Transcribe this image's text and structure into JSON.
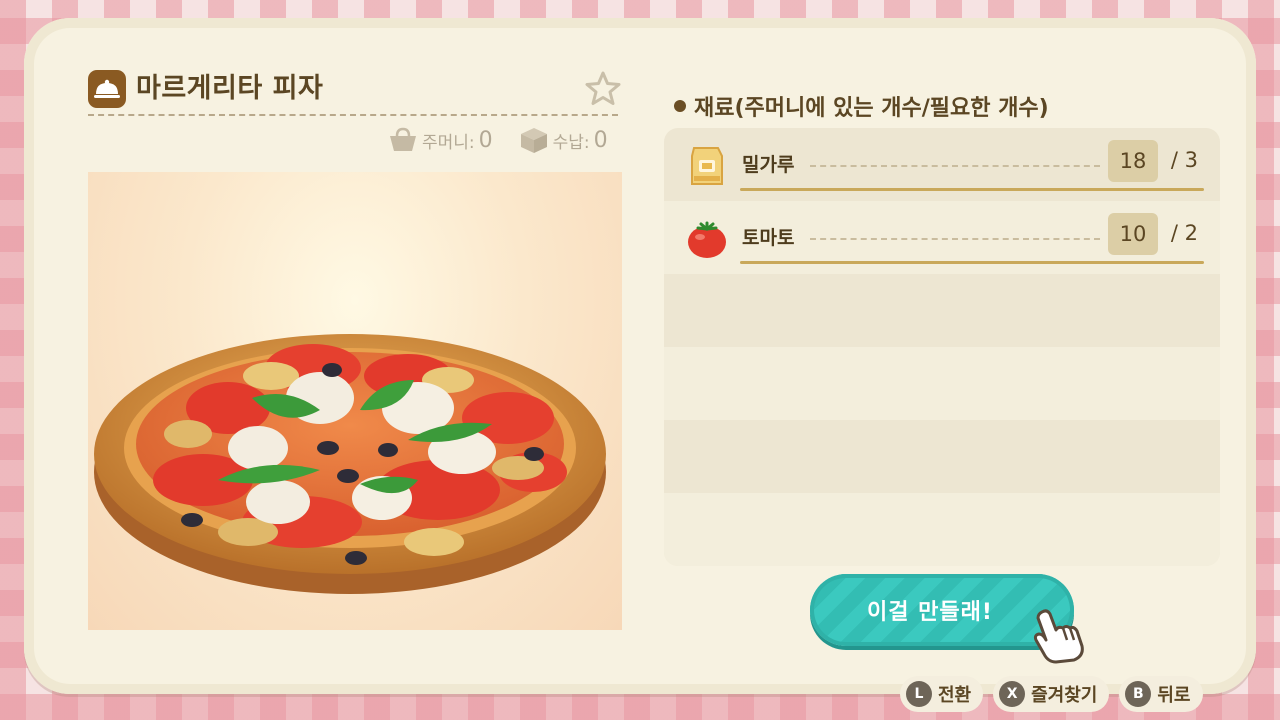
{
  "recipe": {
    "title": "마르게리타 피자",
    "pocket_label": "주머니:",
    "pocket_count": "0",
    "storage_label": "수납:",
    "storage_count": "0"
  },
  "ingredients": {
    "header": "재료(주머니에 있는 개수/필요한 개수)",
    "items": [
      {
        "name": "밀가루",
        "have": "18",
        "need": "/ 3"
      },
      {
        "name": "토마토",
        "have": "10",
        "need": "/ 2"
      }
    ]
  },
  "craft_button": {
    "label": "이걸 만들래!"
  },
  "controls": [
    {
      "button": "L",
      "label": "전환"
    },
    {
      "button": "X",
      "label": "즐겨찾기"
    },
    {
      "button": "B",
      "label": "뒤로"
    }
  ],
  "colors": {
    "accent": "#3bc9bf",
    "text": "#5b4623",
    "card": "#f7f2e1"
  }
}
